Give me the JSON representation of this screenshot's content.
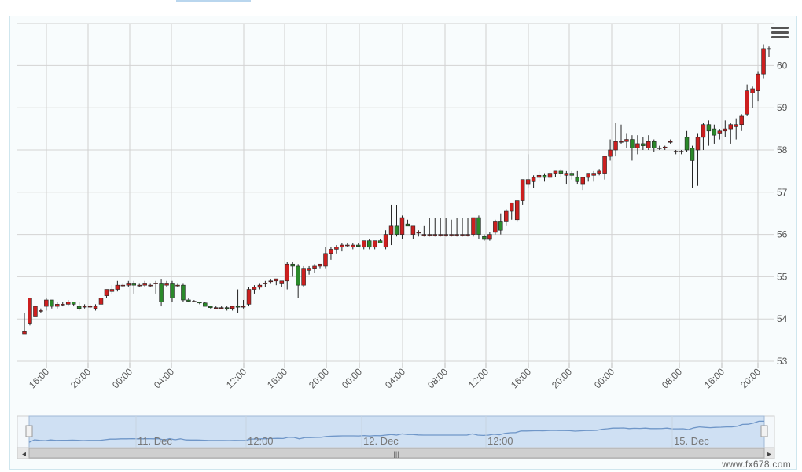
{
  "watermark": "www.fx678.com",
  "menu_icon": "hamburger-menu-icon",
  "chart_data": {
    "type": "candlestick",
    "title": "",
    "xlabel": "",
    "ylabel": "",
    "ylim": [
      53,
      60.5
    ],
    "y_ticks": [
      53,
      54,
      55,
      56,
      57,
      58,
      59,
      60
    ],
    "x_tick_labels": [
      "16:00",
      "20:00",
      "00:00",
      "04:00",
      "12:00",
      "16:00",
      "20:00",
      "00:00",
      "04:00",
      "08:00",
      "12:00",
      "16:00",
      "20:00",
      "00:00",
      "08:00",
      "16:00",
      "20:00"
    ],
    "grid": true,
    "up_color": "#cc1f1f",
    "down_color": "#2a8a2a",
    "ohlc": [
      [
        53.65,
        54.15,
        53.65,
        53.7
      ],
      [
        53.9,
        54.5,
        53.85,
        54.5
      ],
      [
        54.05,
        54.3,
        54.05,
        54.3
      ],
      [
        54.2,
        54.25,
        54.15,
        54.2
      ],
      [
        54.3,
        54.5,
        54.2,
        54.45
      ],
      [
        54.45,
        54.45,
        54.25,
        54.3
      ],
      [
        54.3,
        54.4,
        54.25,
        54.35
      ],
      [
        54.35,
        54.4,
        54.3,
        54.35
      ],
      [
        54.35,
        54.45,
        54.3,
        54.4
      ],
      [
        54.4,
        54.4,
        54.3,
        54.35
      ],
      [
        54.3,
        54.4,
        54.2,
        54.25
      ],
      [
        54.3,
        54.35,
        54.25,
        54.3
      ],
      [
        54.3,
        54.35,
        54.25,
        54.3
      ],
      [
        54.25,
        54.35,
        54.2,
        54.3
      ],
      [
        54.35,
        54.55,
        54.25,
        54.5
      ],
      [
        54.55,
        54.7,
        54.5,
        54.7
      ],
      [
        54.65,
        54.8,
        54.6,
        54.7
      ],
      [
        54.7,
        54.9,
        54.65,
        54.8
      ],
      [
        54.8,
        54.85,
        54.75,
        54.8
      ],
      [
        54.8,
        54.9,
        54.75,
        54.85
      ],
      [
        54.85,
        54.9,
        54.6,
        54.8
      ],
      [
        54.8,
        54.85,
        54.75,
        54.8
      ],
      [
        54.8,
        54.9,
        54.75,
        54.85
      ],
      [
        54.8,
        54.85,
        54.75,
        54.8
      ],
      [
        54.85,
        54.9,
        54.6,
        54.85
      ],
      [
        54.85,
        54.95,
        54.3,
        54.4
      ],
      [
        54.8,
        54.9,
        54.75,
        54.85
      ],
      [
        54.85,
        54.9,
        54.4,
        54.5
      ],
      [
        54.8,
        54.85,
        54.75,
        54.8
      ],
      [
        54.8,
        54.85,
        54.4,
        54.45
      ],
      [
        54.45,
        54.5,
        54.4,
        54.42
      ],
      [
        54.42,
        54.45,
        54.4,
        54.42
      ],
      [
        54.4,
        54.4,
        54.35,
        54.38
      ],
      [
        54.38,
        54.4,
        54.3,
        54.3
      ],
      [
        54.3,
        54.3,
        54.25,
        54.27
      ],
      [
        54.27,
        54.3,
        54.25,
        54.27
      ],
      [
        54.27,
        54.3,
        54.25,
        54.27
      ],
      [
        54.27,
        54.3,
        54.2,
        54.25
      ],
      [
        54.25,
        54.3,
        54.2,
        54.3
      ],
      [
        54.3,
        54.7,
        54.15,
        54.28
      ],
      [
        54.3,
        54.45,
        54.25,
        54.3
      ],
      [
        54.35,
        54.75,
        54.3,
        54.7
      ],
      [
        54.7,
        54.8,
        54.6,
        54.75
      ],
      [
        54.75,
        54.85,
        54.7,
        54.8
      ],
      [
        54.85,
        54.9,
        54.75,
        54.85
      ],
      [
        54.9,
        54.95,
        54.85,
        54.9
      ],
      [
        54.9,
        54.95,
        54.8,
        54.95
      ],
      [
        54.85,
        54.9,
        54.75,
        54.9
      ],
      [
        54.9,
        55.35,
        54.7,
        55.3
      ],
      [
        55.3,
        55.35,
        55.0,
        55.25
      ],
      [
        55.25,
        55.3,
        54.5,
        54.8
      ],
      [
        54.8,
        55.25,
        54.75,
        55.2
      ],
      [
        55.15,
        55.25,
        55.05,
        55.2
      ],
      [
        55.2,
        55.3,
        55.1,
        55.25
      ],
      [
        55.25,
        55.3,
        55.2,
        55.3
      ],
      [
        55.25,
        55.7,
        55.2,
        55.55
      ],
      [
        55.55,
        55.7,
        55.4,
        55.65
      ],
      [
        55.65,
        55.75,
        55.55,
        55.7
      ],
      [
        55.7,
        55.8,
        55.6,
        55.75
      ],
      [
        55.75,
        55.8,
        55.7,
        55.75
      ],
      [
        55.7,
        55.8,
        55.65,
        55.75
      ],
      [
        55.75,
        55.8,
        55.7,
        55.72
      ],
      [
        55.7,
        55.85,
        55.65,
        55.85
      ],
      [
        55.85,
        55.9,
        55.65,
        55.7
      ],
      [
        55.7,
        55.85,
        55.65,
        55.85
      ],
      [
        55.85,
        55.9,
        55.8,
        55.8
      ],
      [
        55.7,
        56.1,
        55.65,
        56.0
      ],
      [
        56.0,
        56.7,
        55.75,
        56.2
      ],
      [
        56.2,
        56.7,
        55.95,
        56.0
      ],
      [
        56.0,
        56.45,
        55.9,
        56.4
      ],
      [
        56.25,
        56.35,
        56.2,
        56.2
      ],
      [
        56.0,
        56.2,
        55.9,
        56.2
      ],
      [
        56.05,
        56.1,
        55.95,
        56.05
      ],
      [
        56.0,
        56.2,
        55.95,
        56.0
      ],
      [
        56.0,
        56.4,
        55.95,
        56.0
      ],
      [
        56.0,
        56.4,
        55.95,
        56.0
      ],
      [
        56.0,
        56.4,
        55.95,
        56.0
      ],
      [
        56.0,
        56.4,
        55.95,
        56.0
      ],
      [
        56.0,
        56.35,
        55.95,
        56.0
      ],
      [
        56.0,
        56.4,
        55.95,
        56.0
      ],
      [
        56.0,
        56.4,
        55.95,
        56.0
      ],
      [
        56.0,
        56.4,
        55.95,
        56.0
      ],
      [
        56.0,
        56.35,
        55.95,
        56.4
      ],
      [
        56.4,
        56.45,
        55.9,
        56.0
      ],
      [
        55.95,
        56.0,
        55.85,
        55.9
      ],
      [
        55.9,
        56.05,
        55.85,
        56.0
      ],
      [
        56.05,
        56.35,
        56.0,
        56.3
      ],
      [
        56.3,
        56.5,
        56.0,
        56.1
      ],
      [
        56.3,
        56.6,
        56.2,
        56.55
      ],
      [
        56.55,
        56.75,
        56.35,
        56.75
      ],
      [
        56.35,
        56.8,
        56.3,
        56.8
      ],
      [
        56.8,
        57.2,
        56.7,
        57.3
      ],
      [
        57.2,
        57.9,
        57.1,
        57.3
      ],
      [
        57.25,
        57.4,
        57.1,
        57.35
      ],
      [
        57.35,
        57.5,
        57.25,
        57.4
      ],
      [
        57.4,
        57.45,
        57.25,
        57.35
      ],
      [
        57.35,
        57.5,
        57.3,
        57.45
      ],
      [
        57.45,
        57.5,
        57.35,
        57.5
      ],
      [
        57.5,
        57.55,
        57.35,
        57.45
      ],
      [
        57.4,
        57.5,
        57.2,
        57.45
      ],
      [
        57.45,
        57.5,
        57.3,
        57.4
      ],
      [
        57.35,
        57.5,
        57.2,
        57.25
      ],
      [
        57.2,
        57.35,
        57.05,
        57.35
      ],
      [
        57.35,
        57.45,
        57.25,
        57.45
      ],
      [
        57.4,
        57.5,
        57.25,
        57.45
      ],
      [
        57.45,
        57.55,
        57.4,
        57.5
      ],
      [
        57.45,
        57.85,
        57.3,
        57.85
      ],
      [
        57.85,
        58.25,
        57.75,
        58.0
      ],
      [
        58.0,
        58.65,
        57.85,
        58.2
      ],
      [
        58.2,
        58.6,
        58.15,
        58.2
      ],
      [
        58.2,
        58.4,
        58.05,
        58.25
      ],
      [
        58.25,
        58.35,
        57.75,
        58.05
      ],
      [
        58.05,
        58.35,
        57.9,
        58.15
      ],
      [
        58.15,
        58.3,
        58.0,
        58.1
      ],
      [
        58.05,
        58.35,
        58.0,
        58.2
      ],
      [
        58.2,
        58.25,
        57.95,
        58.05
      ],
      [
        58.05,
        58.1,
        58.0,
        58.05
      ],
      [
        58.05,
        58.1,
        58.0,
        58.07
      ],
      [
        58.2,
        58.25,
        58.15,
        58.2
      ],
      [
        57.95,
        58.0,
        57.9,
        57.97
      ],
      [
        57.95,
        58.0,
        57.9,
        57.97
      ],
      [
        58.3,
        58.45,
        57.95,
        58.0
      ],
      [
        58.05,
        58.1,
        57.1,
        57.75
      ],
      [
        58.0,
        58.4,
        57.15,
        58.3
      ],
      [
        58.3,
        58.65,
        58.0,
        58.6
      ],
      [
        58.6,
        58.7,
        58.1,
        58.45
      ],
      [
        58.5,
        58.6,
        58.15,
        58.35
      ],
      [
        58.4,
        58.5,
        58.25,
        58.45
      ],
      [
        58.45,
        58.7,
        58.3,
        58.5
      ],
      [
        58.5,
        58.65,
        58.15,
        58.6
      ],
      [
        58.55,
        58.75,
        58.25,
        58.6
      ],
      [
        58.6,
        58.85,
        58.45,
        58.8
      ],
      [
        58.85,
        59.55,
        58.8,
        59.4
      ],
      [
        59.35,
        59.5,
        59.0,
        59.45
      ],
      [
        59.4,
        59.85,
        59.15,
        59.8
      ],
      [
        59.8,
        60.5,
        59.7,
        60.4
      ],
      [
        60.4,
        60.45,
        60.2,
        60.4
      ]
    ]
  },
  "navigator": {
    "labels": [
      "11. Dec",
      "12:00",
      "12. Dec",
      "12:00",
      "15. Dec"
    ],
    "scroll_handle_glyph": "|||",
    "left_arrow": "◂",
    "right_arrow": "▸"
  }
}
